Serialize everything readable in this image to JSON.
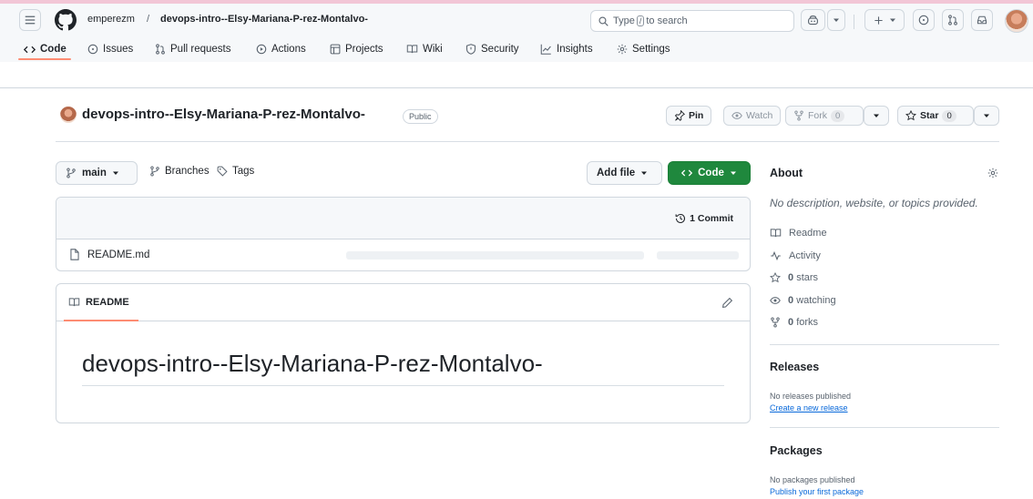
{
  "header": {
    "owner": "emperezm",
    "separator": "/",
    "repo": "devops-intro--Elsy-Mariana-P-rez-Montalvo-",
    "search": {
      "prefix": "Type",
      "key": "/",
      "suffix": "to search"
    }
  },
  "nav": {
    "tabs": [
      {
        "label": "Code",
        "icon": "code-icon",
        "active": true
      },
      {
        "label": "Issues",
        "icon": "issue-icon"
      },
      {
        "label": "Pull requests",
        "icon": "pull-request-icon"
      },
      {
        "label": "Actions",
        "icon": "play-icon"
      },
      {
        "label": "Projects",
        "icon": "table-icon"
      },
      {
        "label": "Wiki",
        "icon": "book-icon"
      },
      {
        "label": "Security",
        "icon": "shield-icon"
      },
      {
        "label": "Insights",
        "icon": "graph-icon"
      },
      {
        "label": "Settings",
        "icon": "gear-icon"
      }
    ]
  },
  "repo": {
    "title": "devops-intro--Elsy-Mariana-P-rez-Montalvo-",
    "visibility": "Public",
    "pin_label": "Pin",
    "watch_label": "Watch",
    "fork_label": "Fork",
    "fork_count": "0",
    "star_label": "Star",
    "star_count": "0"
  },
  "branchbar": {
    "branch": "main",
    "branches_label": "Branches",
    "tags_label": "Tags",
    "add_file_label": "Add file",
    "code_label": "Code"
  },
  "files": {
    "commit_label": "1 Commit",
    "items": [
      {
        "name": "README.md"
      }
    ]
  },
  "readme": {
    "tab_label": "README",
    "heading": "devops-intro--Elsy-Mariana-P-rez-Montalvo-"
  },
  "sidebar": {
    "about_title": "About",
    "about_desc": "No description, website, or topics provided.",
    "readme_label": "Readme",
    "activity_label": "Activity",
    "stars_count": "0",
    "stars_label": "stars",
    "watching_count": "0",
    "watching_label": "watching",
    "forks_count": "0",
    "forks_label": "forks",
    "releases_title": "Releases",
    "releases_empty": "No releases published",
    "releases_link": "Create a new release",
    "packages_title": "Packages",
    "packages_empty": "No packages published",
    "packages_link": "Publish your first package"
  },
  "colors": {
    "accent_green": "#1f883d",
    "tab_underline": "#fd8c73",
    "link_blue": "#0969da",
    "top_stripe": "#f2c6d6"
  }
}
